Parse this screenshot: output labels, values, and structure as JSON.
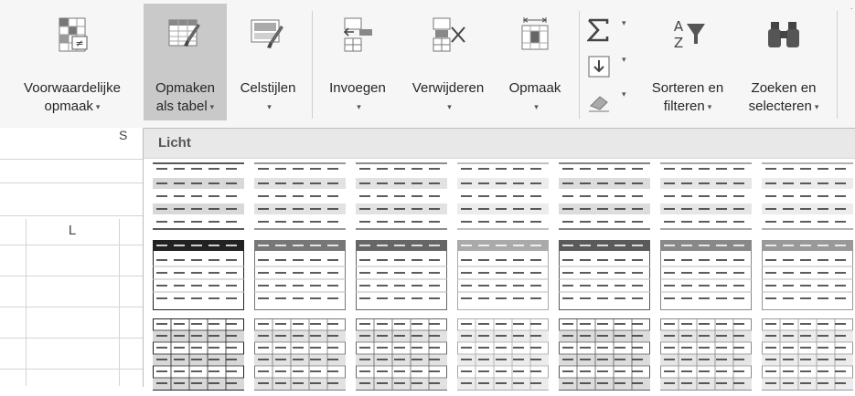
{
  "ribbon": {
    "buttons": [
      {
        "id": "cond",
        "line1": "Voorwaardelijke",
        "line2": "opmaak",
        "caret": "▾"
      },
      {
        "id": "table",
        "line1": "Opmaken",
        "line2": "als tabel",
        "caret": "▾"
      },
      {
        "id": "styles",
        "line1": "Celstijlen",
        "line2": "",
        "caret": "▾"
      },
      {
        "id": "insert",
        "line1": "Invoegen",
        "line2": "",
        "caret": "▾"
      },
      {
        "id": "delete",
        "line1": "Verwijderen",
        "line2": "",
        "caret": "▾"
      },
      {
        "id": "format",
        "line1": "Opmaak",
        "line2": "",
        "caret": "▾"
      },
      {
        "id": "sort",
        "line1": "Sorteren en",
        "line2": "filteren",
        "caret": "▾"
      },
      {
        "id": "find",
        "line1": "Zoeken en",
        "line2": "selecteren",
        "caret": "▾"
      }
    ],
    "small_caret": "▾",
    "group_fragment": "S"
  },
  "sheet": {
    "column_label": "L"
  },
  "gallery": {
    "section_label": "Licht"
  },
  "colors": {
    "ribbon_bg": "#f6f6f6",
    "active_bg": "#c9c9c9",
    "gallery_header": "#e8e8e8"
  }
}
